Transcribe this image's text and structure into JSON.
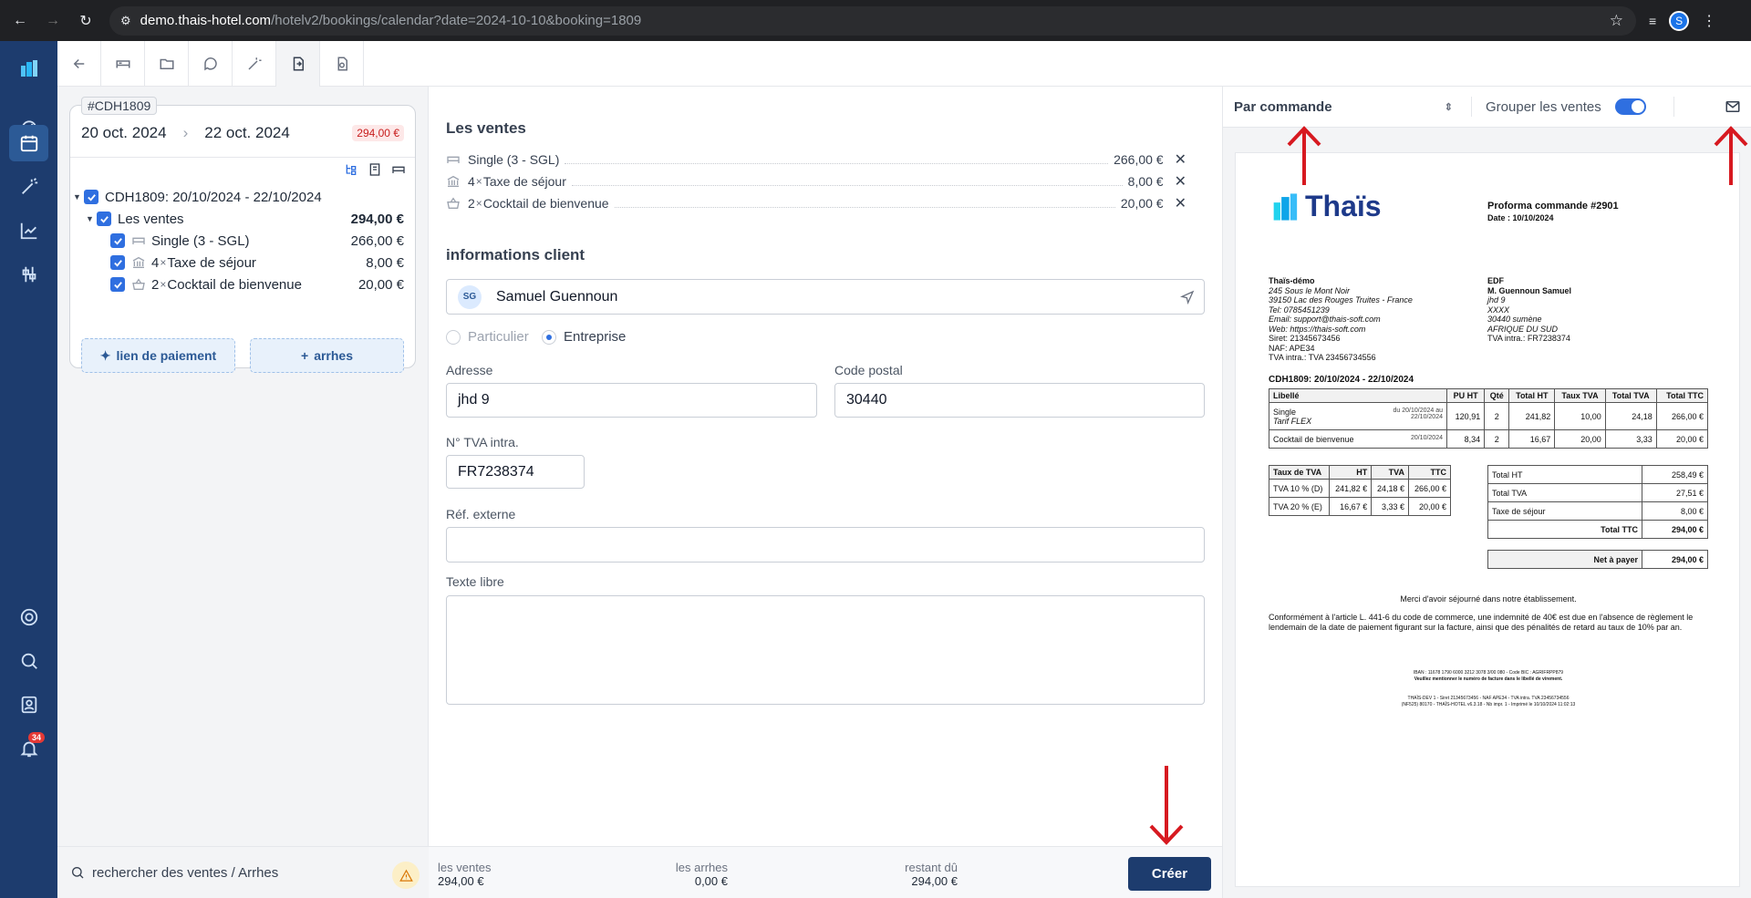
{
  "browser": {
    "url_domain": "demo.thais-hotel.com",
    "url_path": "/hotelv2/bookings/calendar?date=2024-10-10&booking=1809",
    "profile_initial": "S"
  },
  "sidebar": {
    "notifications_count": "34"
  },
  "booking": {
    "tag": "#CDH1809",
    "date_from": "20 oct. 2024",
    "date_to": "22 oct. 2024",
    "total_badge": "294,00 €",
    "group_label": "CDH1809: 20/10/2024 - 22/10/2024",
    "sales_label": "Les ventes",
    "sales_total": "294,00 €",
    "items": [
      {
        "qty": "",
        "name": "Single (3 - SGL)",
        "amount": "266,00 €"
      },
      {
        "qty": "4",
        "name": "Taxe de séjour",
        "amount": "8,00 €"
      },
      {
        "qty": "2",
        "name": "Cocktail de bienvenue",
        "amount": "20,00 €"
      }
    ],
    "payment_link_label": "lien de paiement",
    "deposit_label": "arrhes"
  },
  "left_search": {
    "placeholder": "rechercher des ventes / Arrhes"
  },
  "middle": {
    "sales_title": "Les ventes",
    "sales": [
      {
        "qty": "",
        "name": "Single (3 - SGL)",
        "amount": "266,00 €"
      },
      {
        "qty": "4",
        "name": "Taxe de séjour",
        "amount": "8,00 €"
      },
      {
        "qty": "2",
        "name": "Cocktail de bienvenue",
        "amount": "20,00 €"
      }
    ],
    "client_title": "informations client",
    "client_initials": "SG",
    "client_name": "Samuel Guennoun",
    "type_private": "Particulier",
    "type_company": "Entreprise",
    "address_label": "Adresse",
    "address_value": "jhd 9",
    "postal_label": "Code postal",
    "postal_value": "30440",
    "vat_label": "N° TVA intra.",
    "vat_value": "FR7238374",
    "ref_label": "Réf. externe",
    "free_text_label": "Texte libre",
    "footer": {
      "sales_label": "les ventes",
      "sales_value": "294,00 €",
      "deposit_label": "les arrhes",
      "deposit_value": "0,00 €",
      "due_label": "restant dû",
      "due_value": "294,00 €",
      "create_label": "Créer"
    }
  },
  "right": {
    "mode": "Par commande",
    "group_sales_label": "Grouper les ventes",
    "doc": {
      "logo": "Thaïs",
      "title": "Proforma commande #2901",
      "date": "Date : 10/10/2024",
      "issuer": [
        "Thaïs-démo",
        "245 Sous le Mont Noir",
        "39150 Lac des Rouges Truites - France",
        "Tel: 0785451239",
        "Email: support@thais-soft.com",
        "Web: https://thais-soft.com",
        "Siret: 21345673456",
        "NAF: APE34",
        "TVA intra.: TVA 23456734556"
      ],
      "client": [
        "EDF",
        "M. Guennoun Samuel",
        "jhd 9",
        "XXXX",
        "30440 sumène",
        "AFRIQUE DU SUD",
        "TVA intra.: FR7238374"
      ],
      "section": "CDH1809: 20/10/2024 - 22/10/2024",
      "headers": [
        "Libellé",
        "PU HT",
        "Qté",
        "Total HT",
        "Taux TVA",
        "Total TVA",
        "Total TTC"
      ],
      "rows": [
        {
          "label": "Single",
          "sub": "Tarif FLEX",
          "dates": "du 20/10/2024 au 22/10/2024",
          "pu": "120,91",
          "qty": "2",
          "ht": "241,82",
          "rate": "10,00",
          "tva": "24,18",
          "ttc": "266,00 €"
        },
        {
          "label": "Cocktail de bienvenue",
          "sub": "",
          "dates": "20/10/2024",
          "pu": "8,34",
          "qty": "2",
          "ht": "16,67",
          "rate": "20,00",
          "tva": "3,33",
          "ttc": "20,00 €"
        }
      ],
      "vat_headers": [
        "Taux de TVA",
        "HT",
        "TVA",
        "TTC"
      ],
      "vat_rows": [
        [
          "TVA 10 % (D)",
          "241,82 €",
          "24,18 €",
          "266,00 €"
        ],
        [
          "TVA 20 % (E)",
          "16,67 €",
          "3,33 €",
          "20,00 €"
        ]
      ],
      "totals": [
        [
          "Total HT",
          "258,49 €"
        ],
        [
          "Total TVA",
          "27,51 €"
        ],
        [
          "Taxe de séjour",
          "8,00 €"
        ],
        [
          "Total TTC",
          "294,00 €"
        ]
      ],
      "net_label": "Net à payer",
      "net_value": "294,00 €",
      "thanks": "Merci d'avoir séjourné dans notre établissement.",
      "legal": "Conformément à l'article L. 441-6 du code de commerce, une indemnité de 40€ est due en l'absence de règlement le lendemain de la date de paiement figurant sur la facture, ainsi que des pénalités de retard au taux de 10% par an.",
      "bank": "IBAN : 11678 1790 6000 3212 3078 3/00 080 - Code BIC : AGRIFRPP879",
      "bank_note": "Veuillez mentionner le numéro de facture dans le libellé de virement.",
      "footer1": "THAÏS-DEV 1 - Siret 21345673456 - NAF APE34 - TVA intra. TVA 23456734556",
      "footer2": "(NF525) 80170 - THAÏS-HOTEL v6.3.18 - Nb impr. 1 - Imprimé le 10/10/2024 11:02:13"
    }
  }
}
